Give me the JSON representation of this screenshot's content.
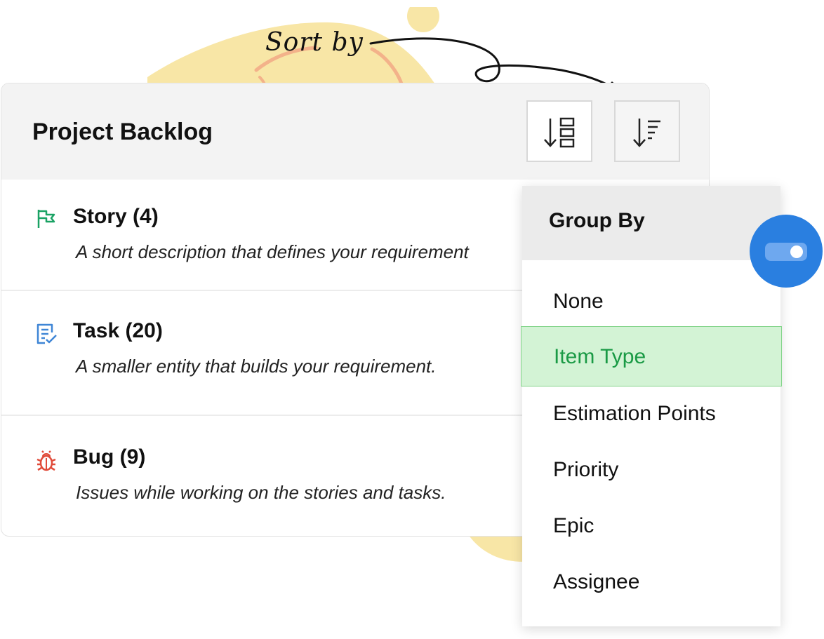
{
  "annotation": {
    "label": "Sort by"
  },
  "backlog": {
    "title": "Project Backlog",
    "group_button_icon": "group-by-icon",
    "sort_button_icon": "sort-icon",
    "items": [
      {
        "title": "Story (4)",
        "description": "A short description that defines your requirement",
        "icon": "flag-icon",
        "color": "#1aa264"
      },
      {
        "title": "Task (20)",
        "description": "A smaller entity that builds your requirement.",
        "icon": "task-checklist-icon",
        "color": "#3f86d6"
      },
      {
        "title": "Bug (9)",
        "description": "Issues while working on the stories and tasks.",
        "icon": "bug-icon",
        "color": "#e04b3a"
      }
    ]
  },
  "group_by": {
    "title": "Group By",
    "options": [
      "None",
      "Item Type",
      "Estimation Points",
      "Priority",
      "Epic",
      "Assignee"
    ],
    "selected": "Item Type"
  },
  "toggle": {
    "state": "on",
    "color": "#2a7fe0"
  },
  "colors": {
    "blob": "#f8e6a6",
    "selected_bg": "#d3f3d5",
    "selected_text": "#1a9a45"
  }
}
